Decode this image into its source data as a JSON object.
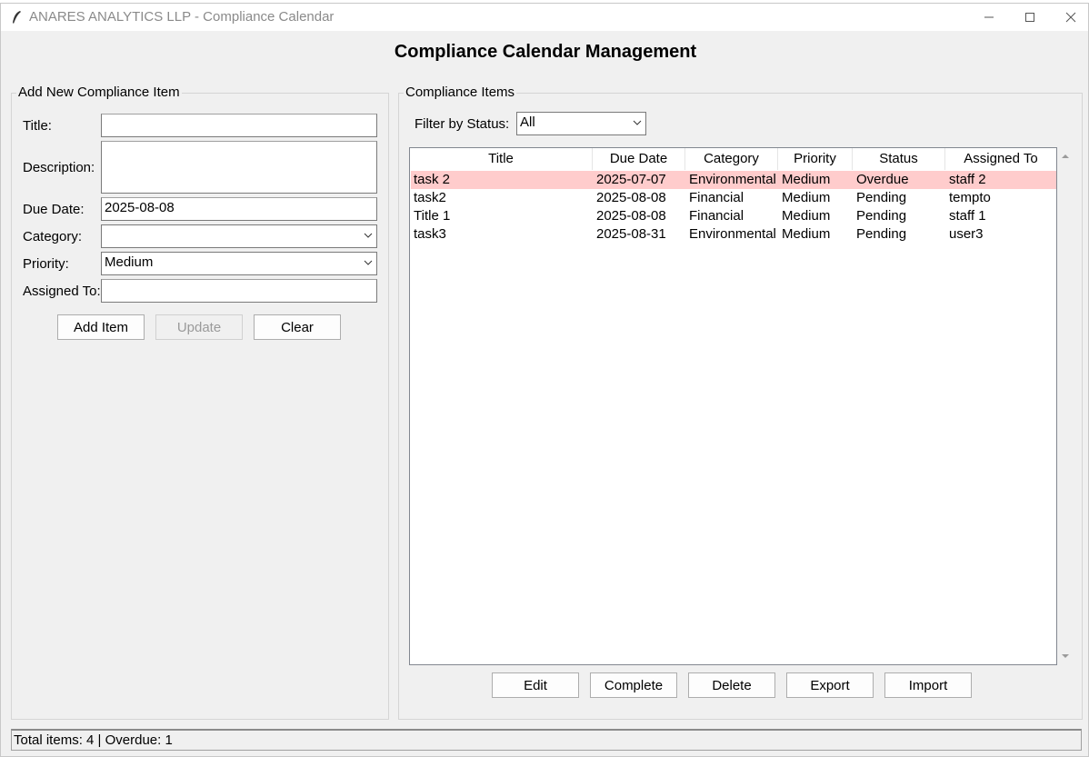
{
  "window": {
    "title": "ANARES ANALYTICS LLP - Compliance Calendar"
  },
  "heading": "Compliance Calendar Management",
  "form": {
    "group_label": "Add New Compliance Item",
    "title_label": "Title:",
    "title_value": "",
    "description_label": "Description:",
    "description_value": "",
    "due_date_label": "Due Date:",
    "due_date_value": "2025-08-08",
    "category_label": "Category:",
    "category_value": "",
    "priority_label": "Priority:",
    "priority_value": "Medium",
    "assigned_label": "Assigned To:",
    "assigned_value": "",
    "add_label": "Add Item",
    "update_label": "Update",
    "clear_label": "Clear"
  },
  "items": {
    "group_label": "Compliance Items",
    "filter_label": "Filter by Status:",
    "filter_value": "All",
    "columns": [
      "Title",
      "Due Date",
      "Category",
      "Priority",
      "Status",
      "Assigned To"
    ],
    "rows": [
      [
        "task 2",
        "2025-07-07",
        "Environmental",
        "Medium",
        "Overdue",
        "staff 2"
      ],
      [
        "task2",
        "2025-08-08",
        "Financial",
        "Medium",
        "Pending",
        "tempto"
      ],
      [
        "Title 1",
        "2025-08-08",
        "Financial",
        "Medium",
        "Pending",
        "staff 1"
      ],
      [
        "task3",
        "2025-08-31",
        "Environmental",
        "Medium",
        "Pending",
        "user3"
      ]
    ],
    "overdue_row_color": "#ffcccc",
    "edit_label": "Edit",
    "complete_label": "Complete",
    "delete_label": "Delete",
    "export_label": "Export",
    "import_label": "Import"
  },
  "status_bar": "Total items: 4 | Overdue: 1"
}
